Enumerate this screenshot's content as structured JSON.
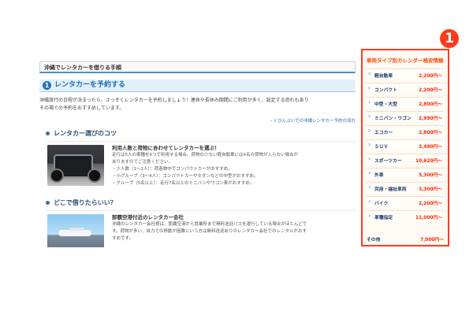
{
  "article": {
    "page_title": "沖縄でレンタカーを借りる手順",
    "step_number": "1",
    "section_title": "レンタカーを予約する",
    "intro_lines": [
      "沖縄旅行の日程が決まったら、さっそくレンタカーを予約しましょう！連休や長休み期間にご利用が多く、設定する恐れもあり",
      "その場での予約をおすすめしています。"
    ],
    "guide_link": "› くびんぷいでの沖縄レンタカー予約の流れ",
    "tips_heading": "レンタカー選びのコツ",
    "tips_card": {
      "title": "利用人数と荷物に合わせてレンタカーを選ぶ！",
      "lines": [
        "走行は5人の車種を6つで利用する場合、荷物の少ない軽自動車には4名の荷物が入らない場合が",
        "ありますのでご注意ください。",
        "・少人数（1～2人）：荷造物中でコンパクトカーがおすすめ。",
        "・小グループ（3～4人）：コンパクトカーやセダンなどの中型がおすすめ。",
        "・グループ（5名以上）：走行7名以上のミニバンやワゴン車がおすすめ。"
      ]
    },
    "location_heading": "どこで借りたらいい？",
    "location_card": {
      "title": "那覇空港付近のレンタカー会社",
      "lines": [
        "沖縄のレンタカー会社様は、那覇空港から営業所まで無料送迎バスを運行している場合がほとんどで",
        "す。荷物が多い、自力での移動が困難という方は無料送迎ありのレンタカー会社でのレンタルがおす",
        "すめです。"
      ]
    }
  },
  "price_panel": {
    "title": "車両タイプ別カレンダー格安情報",
    "items": [
      {
        "label": "軽自動車",
        "price": "2,200円～"
      },
      {
        "label": "コンパクト",
        "price": "2,200円～"
      },
      {
        "label": "中型・大型",
        "price": "2,800円～"
      },
      {
        "label": "ミニバン・ワゴン",
        "price": "2,990円～"
      },
      {
        "label": "エコカー",
        "price": "2,800円～"
      },
      {
        "label": "ＳＵＶ",
        "price": "3,490円～"
      },
      {
        "label": "スポーツカー",
        "price": "10,620円～"
      },
      {
        "label": "外車",
        "price": "5,300円～"
      },
      {
        "label": "完用・福祉車両",
        "price": "3,300円～"
      },
      {
        "label": "バイク",
        "price": "2,200円～"
      },
      {
        "label": "車種指定",
        "price": "11,000円～"
      }
    ],
    "other": {
      "label": "その他",
      "price": "7,000円～"
    }
  },
  "marker_number": "1",
  "icons": {
    "arrow": "chevron-right-icon",
    "bullet": "dot-icon"
  },
  "colors": {
    "accent": "#ff3b1f",
    "brand_blue": "#1f72b8",
    "price": "#ff2600"
  }
}
